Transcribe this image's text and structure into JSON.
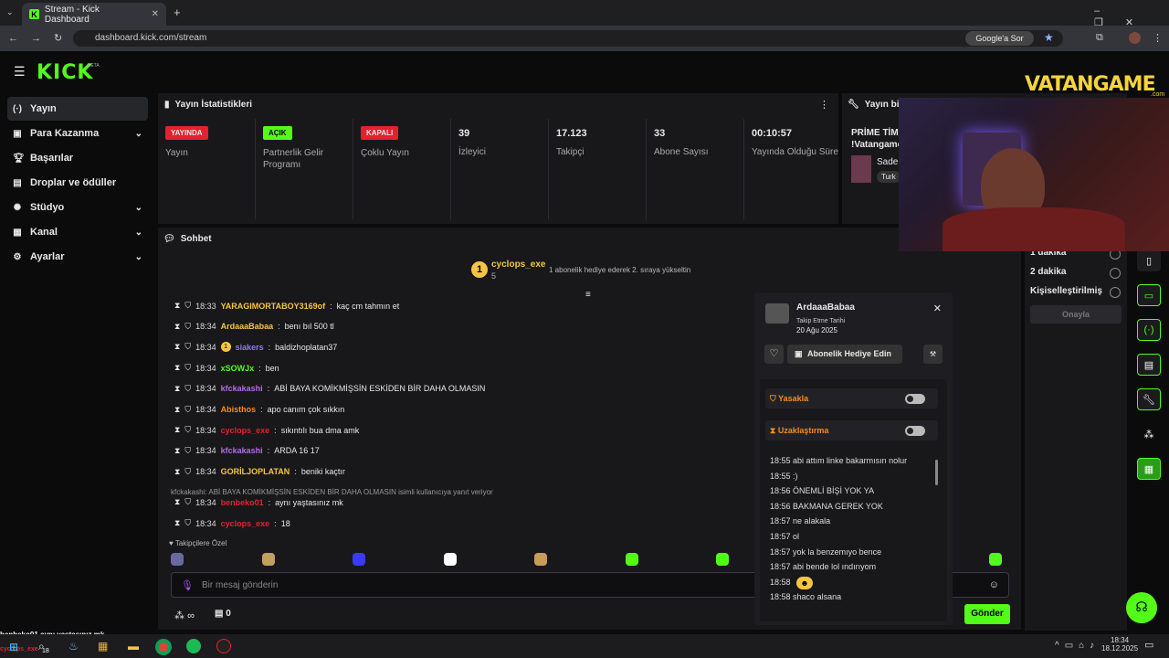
{
  "browser": {
    "tab_title": "Stream - Kick Dashboard",
    "url": "dashboard.kick.com/stream",
    "google_btn": "Google'a Sor"
  },
  "kick": {
    "logo": "KICK",
    "beta": "BETA"
  },
  "sidebar": {
    "items": [
      {
        "label": "Yayın",
        "icon": "broadcast-icon",
        "active": true
      },
      {
        "label": "Para Kazanma",
        "icon": "money-icon",
        "chev": true
      },
      {
        "label": "Başarılar",
        "icon": "trophy-icon"
      },
      {
        "label": "Droplar ve ödüller",
        "icon": "gift-icon"
      },
      {
        "label": "Stüdyo",
        "icon": "studio-icon",
        "chev": true
      },
      {
        "label": "Kanal",
        "icon": "channel-icon",
        "chev": true
      },
      {
        "label": "Ayarlar",
        "icon": "gear-icon",
        "chev": true
      }
    ]
  },
  "stats": {
    "title": "Yayın İstatistikleri",
    "cells": [
      {
        "badge": "YAYINDA",
        "badge_color": "#e5202f",
        "label": "Yayın"
      },
      {
        "badge": "AÇIK",
        "badge_color": "#53fc18",
        "label": "Partnerlik Gelir Programı"
      },
      {
        "badge": "KAPALI",
        "badge_color": "#e5202f",
        "label": "Çoklu Yayın"
      },
      {
        "value": "39",
        "label": "İzleyici"
      },
      {
        "value": "17.123",
        "label": "Takipçi"
      },
      {
        "value": "33",
        "label": "Abone Sayısı"
      },
      {
        "value": "00:10:57",
        "label": "Yayında Olduğu Süre"
      }
    ]
  },
  "bilgi": {
    "title": "Yayın bilg",
    "line1": "PRİME TİMI",
    "line2": "!Vatangame",
    "sub": "Sade",
    "tag": "Turk"
  },
  "chat": {
    "title": "Sohbet",
    "pinned_user": "cyclops_exe",
    "pinned_count": "5",
    "pinned_msg": "1 abonelik hediye ederek 2. sıraya yükseltin",
    "messages": [
      {
        "time": "18:33",
        "user": "YARAGIMORTABOY3169of",
        "color": "#f5c542",
        "text": "kaç cm tahmın et"
      },
      {
        "time": "18:34",
        "user": "ArdaaaBabaa",
        "color": "#f5c542",
        "text": "benı bıl 500 tl"
      },
      {
        "time": "18:34",
        "user": "siakers",
        "color": "#8b7bff",
        "text": "baldizhoplatan37",
        "badge": "1"
      },
      {
        "time": "18:34",
        "user": "xSOWJx",
        "color": "#53fc18",
        "text": "ben"
      },
      {
        "time": "18:34",
        "user": "kfckakashi",
        "color": "#b06cf0",
        "text": "ABİ BAYA KOMİKMİŞSİN ESKİDEN BİR DAHA OLMASIN"
      },
      {
        "time": "18:34",
        "user": "Abisthos",
        "color": "#f28c28",
        "text": "apo canım çok sıkkın"
      },
      {
        "time": "18:34",
        "user": "cyclops_exe",
        "color": "#e5202f",
        "text": "sıkıntılı bua dma amk"
      },
      {
        "time": "18:34",
        "user": "kfckakashi",
        "color": "#b06cf0",
        "text": "ARDA 16 17"
      },
      {
        "time": "18:34",
        "user": "GORİLJOPLATAN",
        "color": "#f5c542",
        "text": "beniki kaçtır"
      }
    ],
    "reply_note": "kfckakashi: ABİ BAYA KOMİKMİŞSİN ESKİDEN BİR DAHA OLMASIN isimli kullanıcıya yanıt veriyor",
    "messages2": [
      {
        "time": "18:34",
        "user": "benbeko01",
        "color": "#e5202f",
        "text": "aynı yaştasınız mk"
      },
      {
        "time": "18:34",
        "user": "cyclops_exe",
        "color": "#e5202f",
        "text": "18"
      }
    ],
    "emote_label": "Takipçilere Özel",
    "input_placeholder": "Bir mesaj gönderin",
    "infinity": "∞",
    "count": "0",
    "send": "Gönder"
  },
  "usercard": {
    "name": "ArdaaaBabaa",
    "follow_label": "Takip Etme Tarihi",
    "follow_date": "20 Ağu 2025",
    "gift_btn": "Abonelik Hediye Edin",
    "ban": "Yasakla",
    "timeout": "Uzaklaştırma",
    "logs": [
      {
        "t": "18:55",
        "m": "abi attım linke bakarmısın nolur"
      },
      {
        "t": "18:55",
        "m": ":)"
      },
      {
        "t": "18:56",
        "m": "ÖNEMLİ BİŞİ YOK YA"
      },
      {
        "t": "18:56",
        "m": "BAKMANA GEREK YOK"
      },
      {
        "t": "18:57",
        "m": "ne alakala"
      },
      {
        "t": "18:57",
        "m": "ol"
      },
      {
        "t": "18:57",
        "m": "yok la benzemıyo bence"
      },
      {
        "t": "18:57",
        "m": "abi bende lol ındırıyom"
      },
      {
        "t": "18:58",
        "m": ""
      },
      {
        "t": "18:58",
        "m": "shaco alsana"
      }
    ]
  },
  "rpanel": {
    "opts": [
      "1 dakika",
      "2 dakika",
      "Kişiselleştirilmiş"
    ],
    "confirm": "Onayla"
  },
  "overlay": {
    "brand": "VATANGAME",
    "sub": ".com",
    "overlay_chat_user": "benbeko01",
    "overlay_chat_text": "aynı yaştasınız mk",
    "overlay_user2": "cyclops_exe",
    "overlay_18": "18"
  },
  "taskbar": {
    "time": "18:34",
    "date": "18.12.2025"
  }
}
